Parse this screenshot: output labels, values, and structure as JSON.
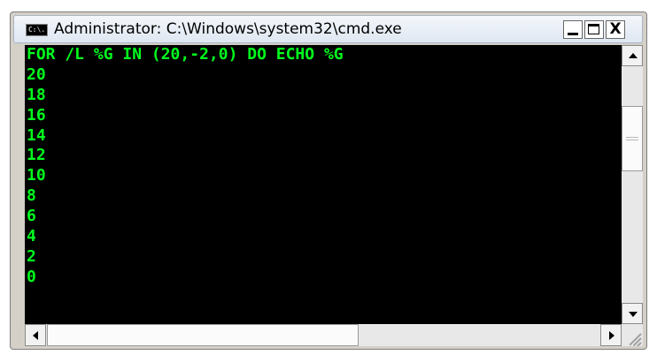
{
  "window": {
    "title": "Administrator: C:\\Windows\\system32\\cmd.exe",
    "app_icon": "cmd-console-icon",
    "app_icon_text": "C:\\.",
    "controls": {
      "minimize": "minimize-icon",
      "maximize": "maximize-icon",
      "close_label": "X"
    }
  },
  "console": {
    "lines": [
      "FOR /L %G IN (20,-2,0) DO ECHO %G",
      "20",
      "18",
      "16",
      "14",
      "12",
      "10",
      "8",
      "6",
      "4",
      "2",
      "0"
    ],
    "text_color": "#00ff1e",
    "background_color": "#000000"
  },
  "scrollbars": {
    "vertical": {
      "up_icon": "arrow-up-icon",
      "down_icon": "arrow-down-icon"
    },
    "horizontal": {
      "left_icon": "arrow-left-icon",
      "right_icon": "arrow-right-icon"
    }
  }
}
